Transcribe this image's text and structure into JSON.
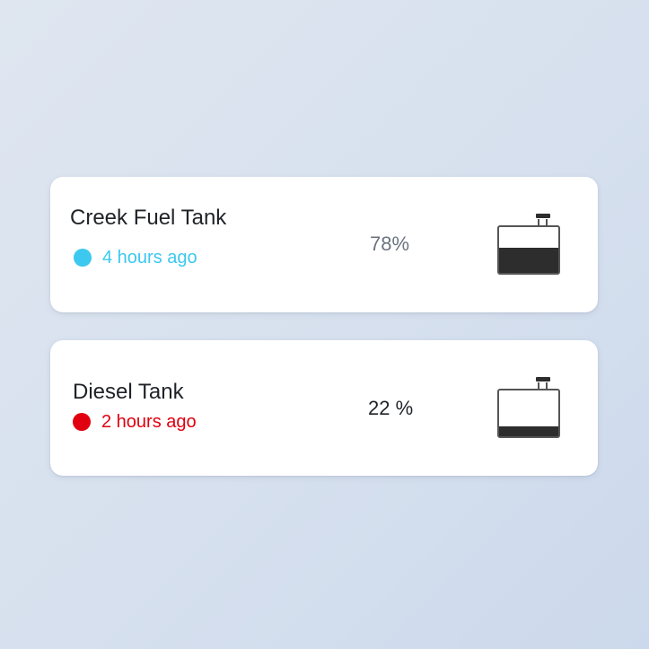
{
  "tanks": [
    {
      "name": "Creek Fuel Tank",
      "status_text": "4 hours ago",
      "status_color": "#3cc8ef",
      "level_value": "78",
      "level_unit": "%",
      "level_text_color": "#6b7480",
      "fill_fraction": 0.55,
      "icon": "fuel-tank-icon"
    },
    {
      "name": "Diesel Tank",
      "status_text": "2 hours ago",
      "status_color": "#e0000f",
      "level_value": "22",
      "level_unit": "%",
      "level_text_color": "#1f2328",
      "fill_fraction": 0.22,
      "icon": "fuel-tank-icon"
    }
  ],
  "colors": {
    "card_background": "#ffffff",
    "tank_fill": "#2d2d2d",
    "tank_outline": "#555555"
  }
}
